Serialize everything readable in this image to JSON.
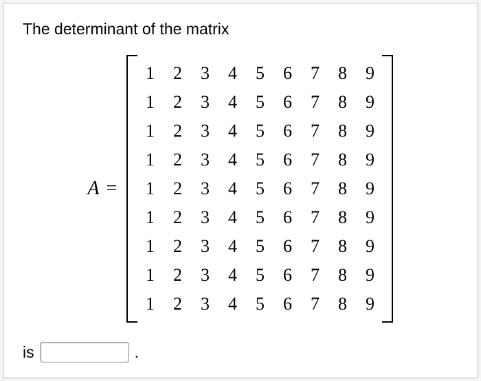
{
  "question": {
    "intro": "The determinant of the matrix",
    "variable": "A",
    "equals": "=",
    "matrix": [
      [
        "1",
        "2",
        "3",
        "4",
        "5",
        "6",
        "7",
        "8",
        "9"
      ],
      [
        "1",
        "2",
        "3",
        "4",
        "5",
        "6",
        "7",
        "8",
        "9"
      ],
      [
        "1",
        "2",
        "3",
        "4",
        "5",
        "6",
        "7",
        "8",
        "9"
      ],
      [
        "1",
        "2",
        "3",
        "4",
        "5",
        "6",
        "7",
        "8",
        "9"
      ],
      [
        "1",
        "2",
        "3",
        "4",
        "5",
        "6",
        "7",
        "8",
        "9"
      ],
      [
        "1",
        "2",
        "3",
        "4",
        "5",
        "6",
        "7",
        "8",
        "9"
      ],
      [
        "1",
        "2",
        "3",
        "4",
        "5",
        "6",
        "7",
        "8",
        "9"
      ],
      [
        "1",
        "2",
        "3",
        "4",
        "5",
        "6",
        "7",
        "8",
        "9"
      ],
      [
        "1",
        "2",
        "3",
        "4",
        "5",
        "6",
        "7",
        "8",
        "9"
      ]
    ],
    "is_text": "is",
    "period": ".",
    "answer_value": ""
  }
}
